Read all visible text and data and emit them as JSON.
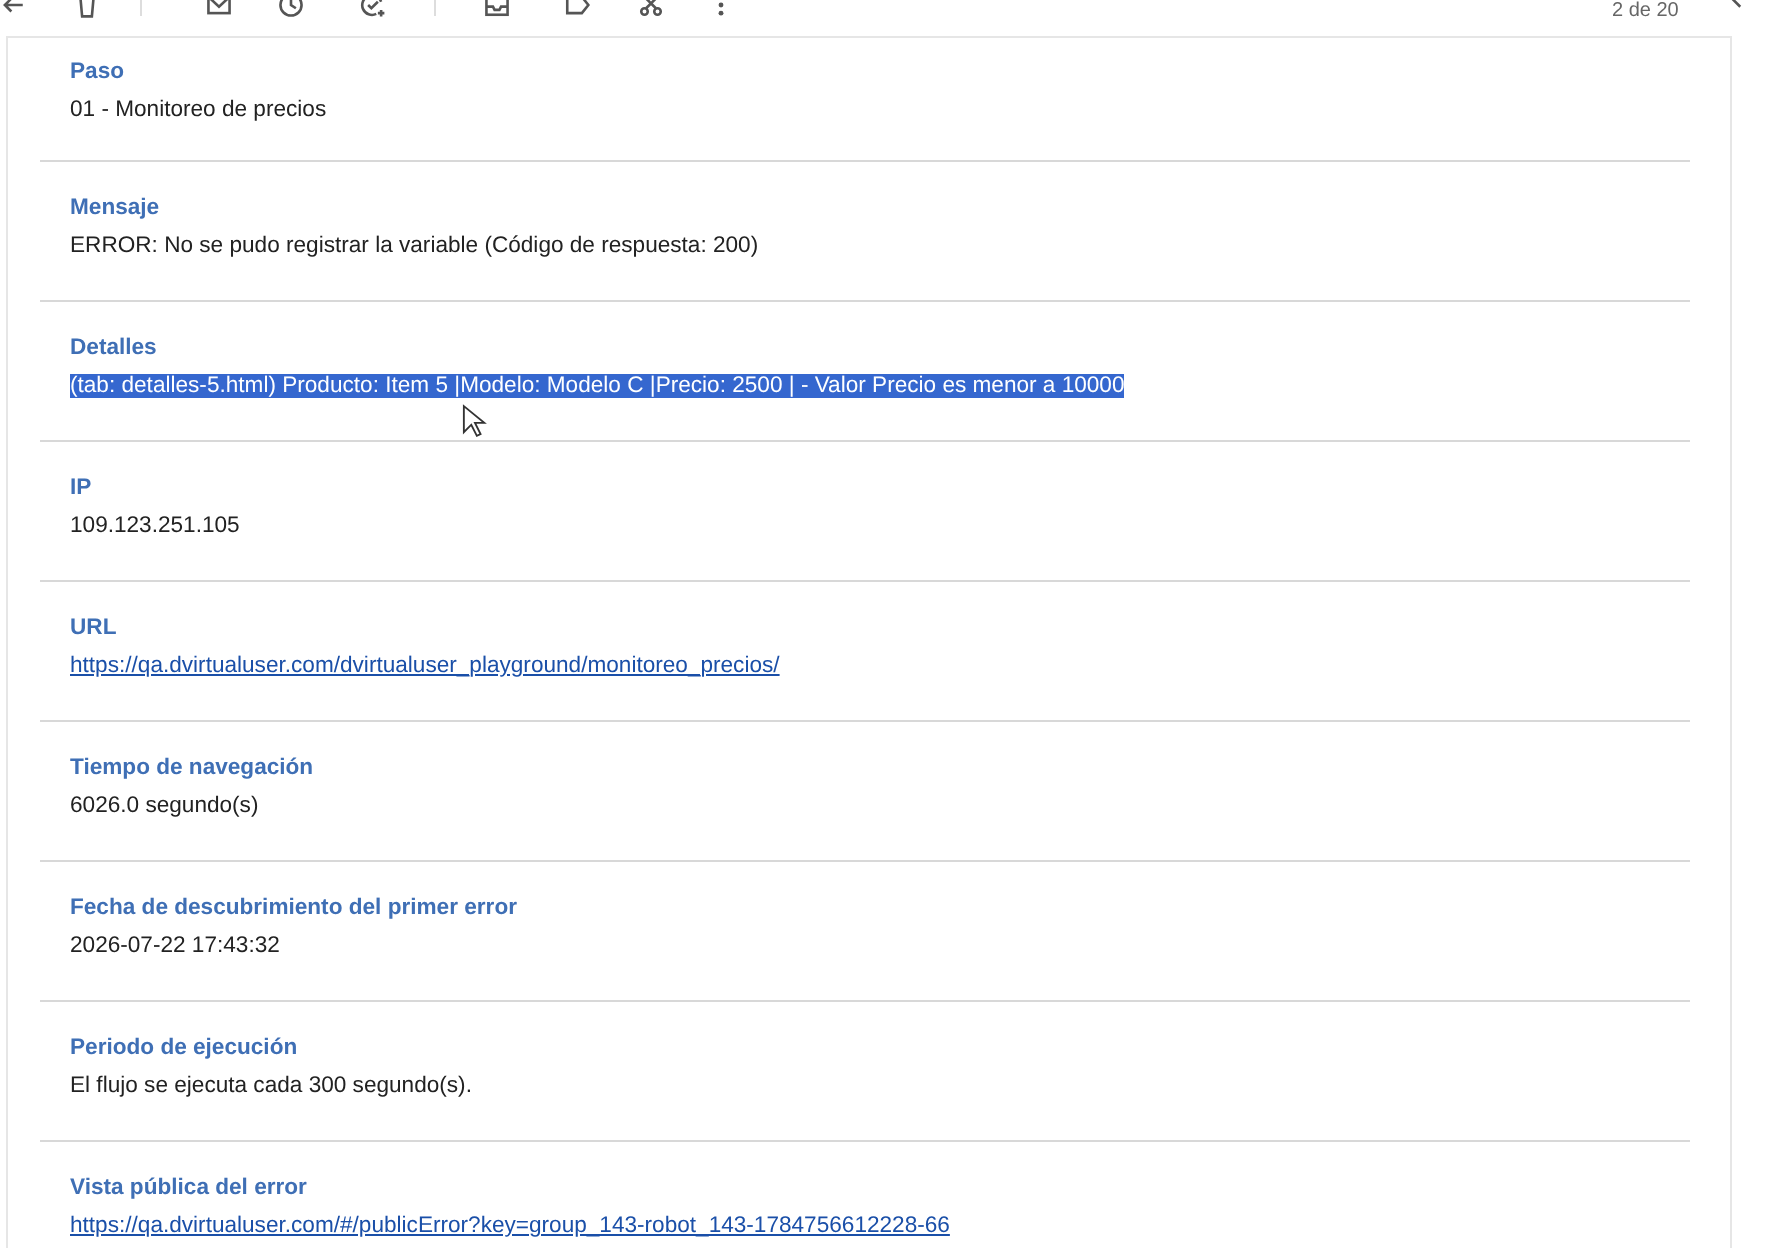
{
  "toolbar": {
    "counter": "2 de 20"
  },
  "fields": [
    {
      "label": "Paso",
      "value": "01 - Monitoreo de precios",
      "kind": "text",
      "highlighted": false
    },
    {
      "label": "Mensaje",
      "value": "ERROR: No se pudo registrar la variable (Código de respuesta: 200)",
      "kind": "text",
      "highlighted": false
    },
    {
      "label": "Detalles",
      "value": "(tab: detalles-5.html) Producto: Item 5 |Modelo: Modelo C |Precio: 2500 | - Valor Precio es menor a 10000",
      "kind": "text",
      "highlighted": true
    },
    {
      "label": "IP",
      "value": "109.123.251.105",
      "kind": "text",
      "highlighted": false
    },
    {
      "label": "URL",
      "value": "https://qa.dvirtualuser.com/dvirtualuser_playground/monitoreo_precios/",
      "kind": "link",
      "highlighted": false
    },
    {
      "label": "Tiempo de navegación",
      "value": "6026.0 segundo(s)",
      "kind": "text",
      "highlighted": false
    },
    {
      "label": "Fecha de descubrimiento del primer error",
      "value": "2026-07-22 17:43:32",
      "kind": "text",
      "highlighted": false
    },
    {
      "label": "Periodo de ejecución",
      "value": "El flujo se ejecuta cada 300 segundo(s).",
      "kind": "text",
      "highlighted": false
    },
    {
      "label": "Vista pública del error",
      "value": "https://qa.dvirtualuser.com/#/publicError?key=group_143-robot_143-1784756612228-66",
      "kind": "link",
      "highlighted": false
    }
  ]
}
